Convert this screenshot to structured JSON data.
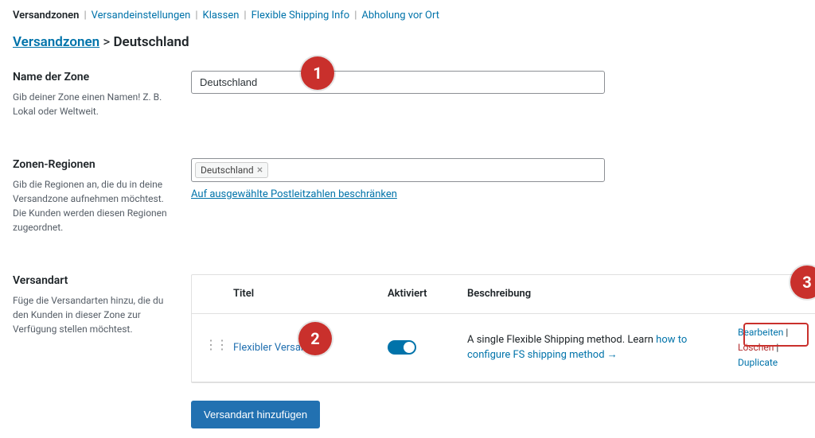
{
  "tabs": {
    "zones": "Versandzonen",
    "settings": "Versandeinstellungen",
    "classes": "Klassen",
    "fsinfo": "Flexible Shipping Info",
    "pickup": "Abholung vor Ort"
  },
  "breadcrumb": {
    "root": "Versandzonen",
    "sep": ">",
    "current": "Deutschland"
  },
  "zoneName": {
    "label": "Name der Zone",
    "help": "Gib deiner Zone einen Namen! Z. B. Lokal oder Weltweit.",
    "value": "Deutschland"
  },
  "zoneRegions": {
    "label": "Zonen-Regionen",
    "help": "Gib die Regionen an, die du in deine Versandzone aufnehmen möchtest. Die Kunden werden diesen Regionen zugeordnet.",
    "tag": "Deutschland",
    "plzLink": "Auf ausgewählte Postleitzahlen beschränken"
  },
  "methods": {
    "label": "Versandart",
    "help": "Füge die Versandarten hinzu, die du den Kunden in dieser Zone zur Verfügung stellen möchtest.",
    "head": {
      "title": "Titel",
      "enabled": "Aktiviert",
      "desc": "Beschreibung"
    },
    "row": {
      "title": "Flexibler Versand",
      "descPrefix": "A single Flexible Shipping method. Learn ",
      "descLink": "how to configure FS shipping method →"
    },
    "actions": {
      "edit": "Bearbeiten",
      "delete": "Löschen",
      "duplicate": "Duplicate"
    },
    "addButton": "Versandart hinzufügen"
  },
  "markers": {
    "m1": "1",
    "m2": "2",
    "m3": "3"
  }
}
